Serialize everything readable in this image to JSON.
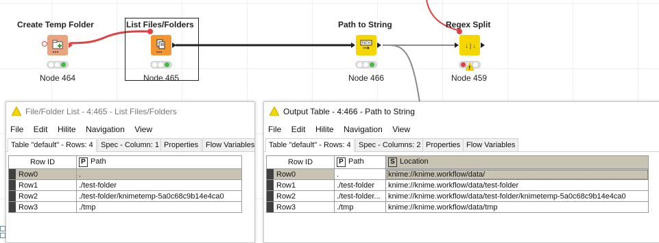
{
  "workflow": {
    "nodes": [
      {
        "title": "Create Temp Folder",
        "label": "Node 464",
        "color": "#e9a47e"
      },
      {
        "title": "List Files/Folders",
        "label": "Node 465",
        "color": "#f39530"
      },
      {
        "title": "Path to String",
        "label": "Node 466",
        "color": "#f5d600"
      },
      {
        "title": "Regex Split",
        "label": "Node 459",
        "color": "#f5d600"
      }
    ],
    "status_colors": {
      "ok": "#3ebd3e",
      "warn": "#f5d600",
      "err": "#e04040",
      "idle": "#ffffff"
    },
    "connection_colors": {
      "flow_variable": "#e04040",
      "data": "#222222",
      "inactive": "#999999"
    },
    "icons": [
      "folder-plus-icon",
      "file-list-icon",
      "path-to-string-icon",
      "regex-split-icon",
      "warning-icon"
    ]
  },
  "left_window": {
    "title": "File/Folder List - 4:465 - List Files/Folders",
    "menu": [
      "File",
      "Edit",
      "Hilite",
      "Navigation",
      "View"
    ],
    "tabs": [
      "Table \"default\" - Rows: 4",
      "Spec - Column: 1",
      "Properties",
      "Flow Variables"
    ],
    "table": {
      "headers": [
        "Row ID",
        "Path"
      ],
      "header_types": [
        "",
        "P"
      ],
      "rows": [
        [
          "Row0",
          "."
        ],
        [
          "Row1",
          "./test-folder"
        ],
        [
          "Row2",
          "./test-folder/knimetemp-5a0c68c9b14e4ca0"
        ],
        [
          "Row3",
          "./tmp"
        ]
      ]
    }
  },
  "right_window": {
    "title": "Output Table - 4:466 - Path to String",
    "menu": [
      "File",
      "Edit",
      "Hilite",
      "Navigation",
      "View"
    ],
    "tabs": [
      "Table \"default\" - Rows: 4",
      "Spec - Columns: 2",
      "Properties",
      "Flow Variables"
    ],
    "table": {
      "headers": [
        "Row ID",
        "Path",
        "Location"
      ],
      "header_types": [
        "",
        "P",
        "S"
      ],
      "rows": [
        [
          "Row0",
          ".",
          "knime://knime.workflow/data/"
        ],
        [
          "Row1",
          "./test-folder",
          "knime://knime.workflow/data/test-folder"
        ],
        [
          "Row2",
          "./test-folder...",
          "knime://knime.workflow/data/test-folder/knimetemp-5a0c68c9b14e4ca0"
        ],
        [
          "Row3",
          "./tmp",
          "knime://knime.workflow/data/tmp"
        ]
      ]
    }
  },
  "theme": {
    "selected_row": "#c9c3b4",
    "warning_triangle": "#f5d600"
  }
}
